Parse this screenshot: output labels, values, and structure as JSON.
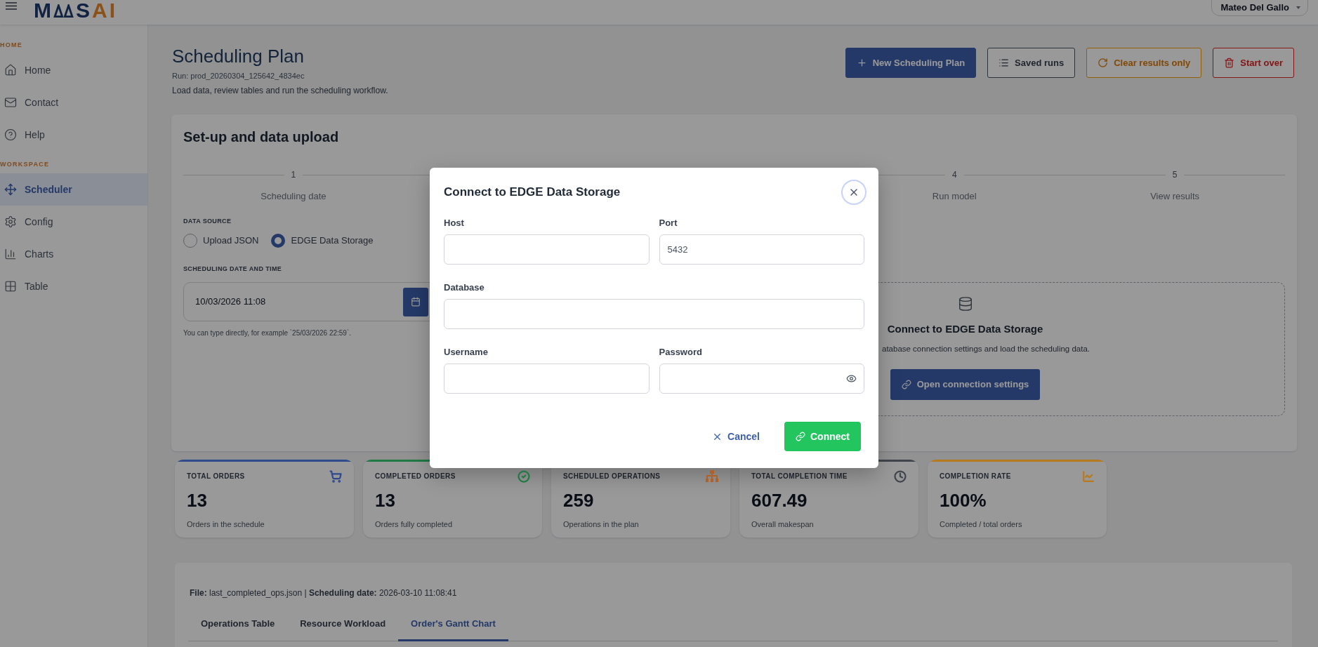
{
  "header": {
    "logo": {
      "lead": "M",
      "middle": "S",
      "accent": "AI"
    },
    "user": {
      "name": "Mateo Del Gallo"
    }
  },
  "sidebar": {
    "sections": [
      {
        "title": "HOME",
        "items": [
          {
            "label": "Home",
            "selected": false
          },
          {
            "label": "Contact",
            "selected": false
          },
          {
            "label": "Help",
            "selected": false
          }
        ]
      },
      {
        "title": "WORKSPACE",
        "items": [
          {
            "label": "Scheduler",
            "selected": true
          },
          {
            "label": "Config",
            "selected": false
          },
          {
            "label": "Charts",
            "selected": false
          },
          {
            "label": "Table",
            "selected": false
          }
        ]
      }
    ]
  },
  "page": {
    "title": "Scheduling Plan",
    "run": "Run: prod_20260304_125642_4834ec",
    "description": "Load data, review tables and run the scheduling workflow.",
    "actions": [
      {
        "label": "New Scheduling Plan",
        "kind": "primary"
      },
      {
        "label": "Saved runs",
        "kind": "neutral"
      },
      {
        "label": "Clear results only",
        "kind": "warning"
      },
      {
        "label": "Start over",
        "kind": "danger"
      }
    ]
  },
  "setup_card": {
    "title": "Set-up and data upload",
    "steps": [
      {
        "number": "1",
        "label": "Scheduling date"
      },
      {
        "number": "4",
        "label": "Run model"
      },
      {
        "number": "5",
        "label": "View results"
      }
    ],
    "data_source": {
      "label": "DATA SOURCE",
      "options": [
        {
          "label": "Upload JSON",
          "selected": false
        },
        {
          "label": "EDGE Data Storage",
          "selected": true
        }
      ]
    },
    "datetime": {
      "label": "SCHEDULING DATE AND TIME",
      "value": "10/03/2026 11:08",
      "hint": "You can type directly, for example `25/03/2026 22:59`."
    },
    "edge_panel": {
      "title": "Connect to EDGE Data Storage",
      "text": "atabase connection settings and load the scheduling data.",
      "button": "Open connection settings"
    }
  },
  "stats": [
    {
      "label": "TOTAL ORDERS",
      "value": "13",
      "caption": "Orders in the schedule",
      "color": "#2e4a8c"
    },
    {
      "label": "COMPLETED ORDERS",
      "value": "13",
      "caption": "Orders fully completed",
      "color": "#1f7a45"
    },
    {
      "label": "SCHEDULED OPERATIONS",
      "value": "259",
      "caption": "Operations in the plan",
      "color": "#b06127"
    },
    {
      "label": "TOTAL COMPLETION TIME",
      "value": "607.49",
      "caption": "Overall makespan",
      "color": "#40454d"
    },
    {
      "label": "COMPLETION RATE",
      "value": "100%",
      "caption": "Completed / total orders",
      "color": "#b87a1e"
    }
  ],
  "results": {
    "file_info": "**File:** last_completed_ops.json | **Scheduling date:** 2026-03-10 11:08:41",
    "tabs": [
      {
        "label": "Operations Table",
        "selected": false
      },
      {
        "label": "Resource Workload",
        "selected": false
      },
      {
        "label": "Order's Gantt Chart",
        "selected": true
      }
    ]
  },
  "dialog": {
    "title": "Connect to EDGE Data Storage",
    "rows": [
      [
        {
          "label": "Host",
          "kind": "text"
        },
        {
          "label": "Port",
          "kind": "text",
          "value": "5432"
        }
      ],
      [
        {
          "label": "Database",
          "kind": "text"
        }
      ],
      [
        {
          "label": "Username",
          "kind": "text"
        },
        {
          "label": "Password",
          "kind": "password"
        }
      ]
    ],
    "buttons": [
      {
        "label": "Cancel",
        "kind": "secondary"
      },
      {
        "label": "Connect",
        "kind": "primary"
      }
    ]
  }
}
